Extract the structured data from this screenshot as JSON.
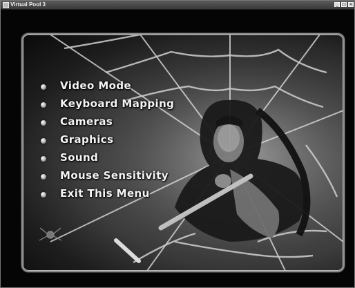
{
  "window": {
    "title": "Virtual Pool 3",
    "minimize_glyph": "_",
    "maximize_glyph": "□",
    "close_glyph": "×"
  },
  "menu": {
    "items": [
      {
        "label": "Video Mode",
        "icon": "bullet-icon"
      },
      {
        "label": "Keyboard Mapping",
        "icon": "bullet-icon"
      },
      {
        "label": "Cameras",
        "icon": "bullet-icon"
      },
      {
        "label": "Graphics",
        "icon": "bullet-icon"
      },
      {
        "label": "Sound",
        "icon": "bullet-icon"
      },
      {
        "label": "Mouse Sensitivity",
        "icon": "bullet-icon"
      },
      {
        "label": "Exit This Menu",
        "icon": "bullet-icon"
      }
    ]
  },
  "colors": {
    "background": "#050505",
    "menu_text": "#f4f4f4",
    "frame": "#8a8a8a"
  }
}
